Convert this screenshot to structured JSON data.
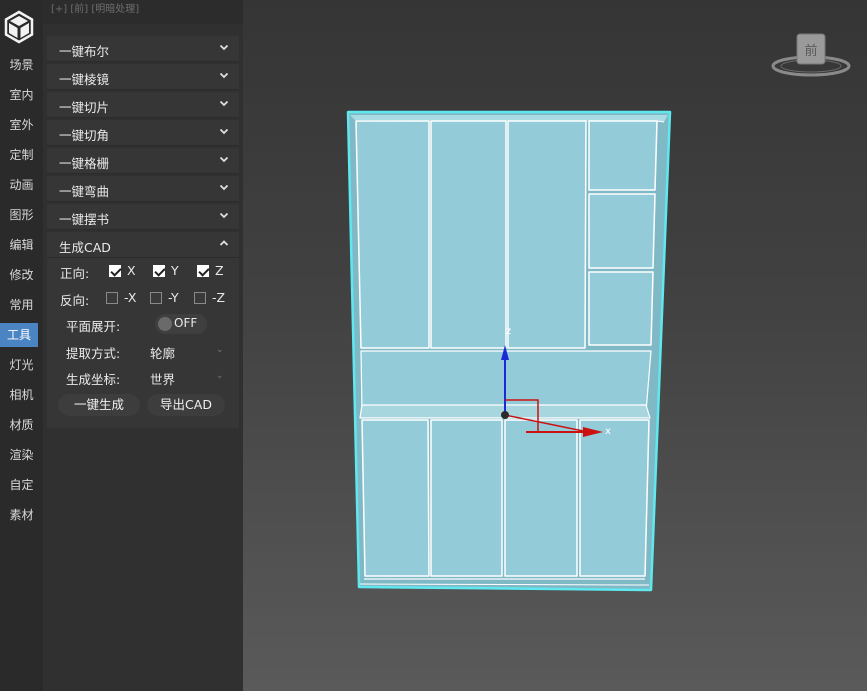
{
  "rail": {
    "items": [
      "场景",
      "室内",
      "室外",
      "定制",
      "动画",
      "图形",
      "编辑",
      "修改",
      "常用",
      "工具",
      "灯光",
      "相机",
      "材质",
      "渲染",
      "自定",
      "素材"
    ],
    "active": "工具"
  },
  "panel": {
    "top_text": "[+] [前] [明暗处理]",
    "menus": [
      "一键布尔",
      "一键棱镜",
      "一键切片",
      "一键切角",
      "一键格栅",
      "一键弯曲",
      "一键摆书"
    ],
    "cad": {
      "title": "生成CAD",
      "forward_label": "正向:",
      "forward": [
        {
          "label": "X",
          "checked": true
        },
        {
          "label": "Y",
          "checked": true
        },
        {
          "label": "Z",
          "checked": true
        }
      ],
      "reverse_label": "反向:",
      "reverse": [
        {
          "label": "-X",
          "checked": false
        },
        {
          "label": "-Y",
          "checked": false
        },
        {
          "label": "-Z",
          "checked": false
        }
      ],
      "flat_label": "平面展开:",
      "flat_state": "OFF",
      "extract_label": "提取方式:",
      "extract_value": "轮廓",
      "coord_label": "生成坐标:",
      "coord_value": "世界",
      "generate_button": "一键生成",
      "export_button": "导出CAD"
    }
  },
  "viewport": {
    "viewcube_label": "前",
    "axis_x": "x",
    "axis_z": "z",
    "colors": {
      "wire": "#5fe8f0",
      "panel": "#93ccd8",
      "x_axis": "#cc1111",
      "z_axis": "#1a2bd6"
    }
  }
}
